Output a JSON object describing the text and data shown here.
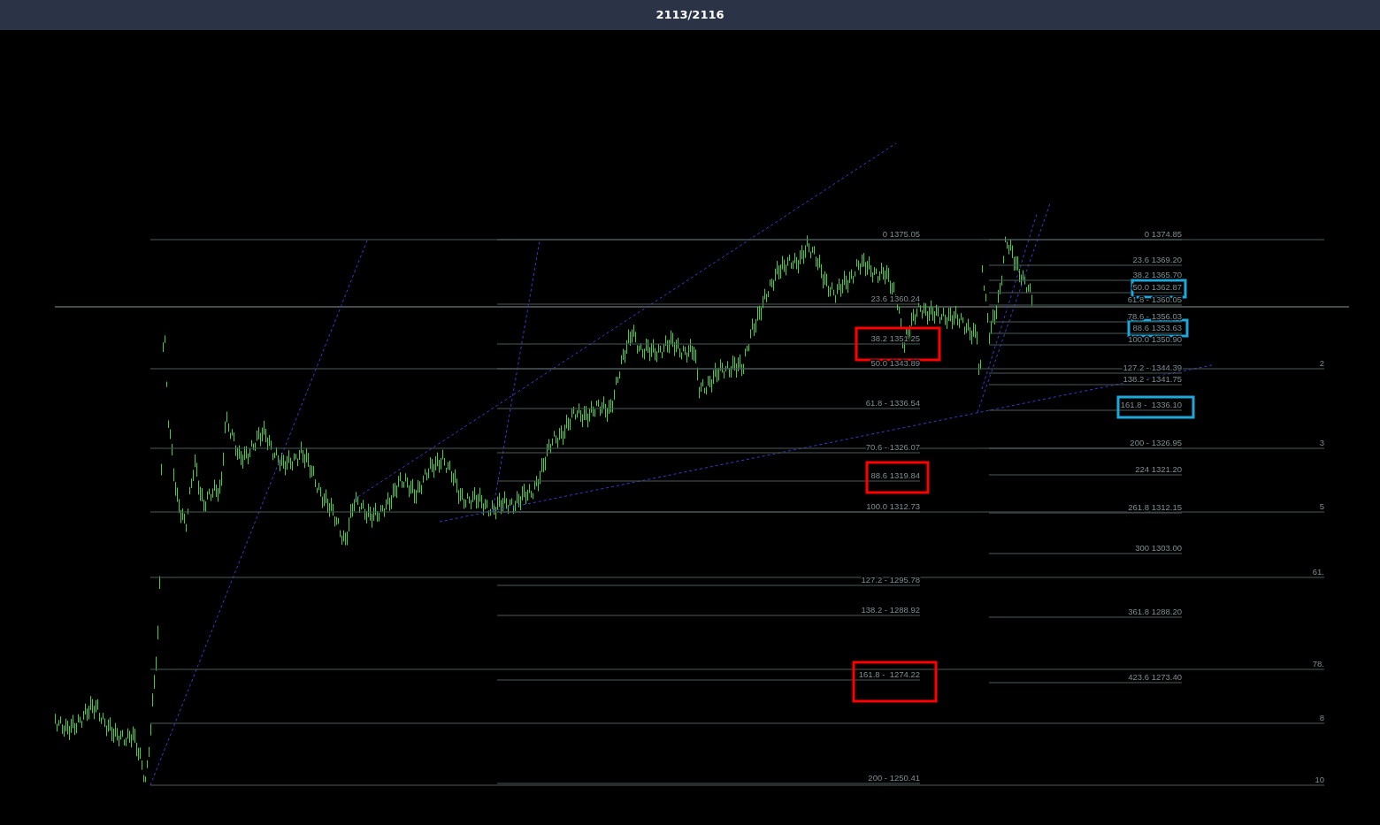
{
  "title": "2113/2116",
  "fib_sets": [
    {
      "levels": [
        {
          "label": "0 1375.05"
        },
        {
          "label": "23.6 1360.24"
        },
        {
          "label": "38.2 1351.25",
          "color": "#ff0000"
        },
        {
          "label": "50.0 1343.89"
        },
        {
          "label": "61.8 - 1336.54"
        },
        {
          "label": "70.6 - 1326.07"
        },
        {
          "label": "88.6 1319.84",
          "color": "#ff0000"
        },
        {
          "label": "100.0 1312.73"
        },
        {
          "label": "127.2 - 1295.78"
        },
        {
          "label": "138.2 - 1288.92"
        },
        {
          "label": "161.8 -  1274.22",
          "color": "#ff0000"
        },
        {
          "label": "200 - 1250.41"
        }
      ]
    },
    {
      "levels": [
        {
          "label": "0 1374.85"
        },
        {
          "label": "23.6 1369.20"
        },
        {
          "label": "38.2 1365.70"
        },
        {
          "label": "50.0 1362.87",
          "color": "#1ea7d8"
        },
        {
          "label": "61.8 - 1360.05"
        },
        {
          "label": "78.6 - 1356.03"
        },
        {
          "label": "88.6 1353.63",
          "color": "#1ea7d8"
        },
        {
          "label": "100.0 1350.90"
        },
        {
          "label": "127.2 - 1344.39"
        },
        {
          "label": "138.2 - 1341.75"
        },
        {
          "label": "161.8 -  1336.10",
          "color": "#1ea7d8"
        },
        {
          "label": "200 - 1326.95"
        },
        {
          "label": "224 1321.20"
        },
        {
          "label": "261.8 1312.15"
        },
        {
          "label": "300 1303.00"
        },
        {
          "label": "361.8 1288.20"
        },
        {
          "label": "423.6 1273.40"
        }
      ]
    },
    {
      "levels": [
        {
          "label": "2"
        },
        {
          "label": "3"
        },
        {
          "label": "5"
        },
        {
          "label": "61."
        },
        {
          "label": "78."
        },
        {
          "label": "8"
        },
        {
          "label": "10"
        }
      ]
    }
  ]
}
